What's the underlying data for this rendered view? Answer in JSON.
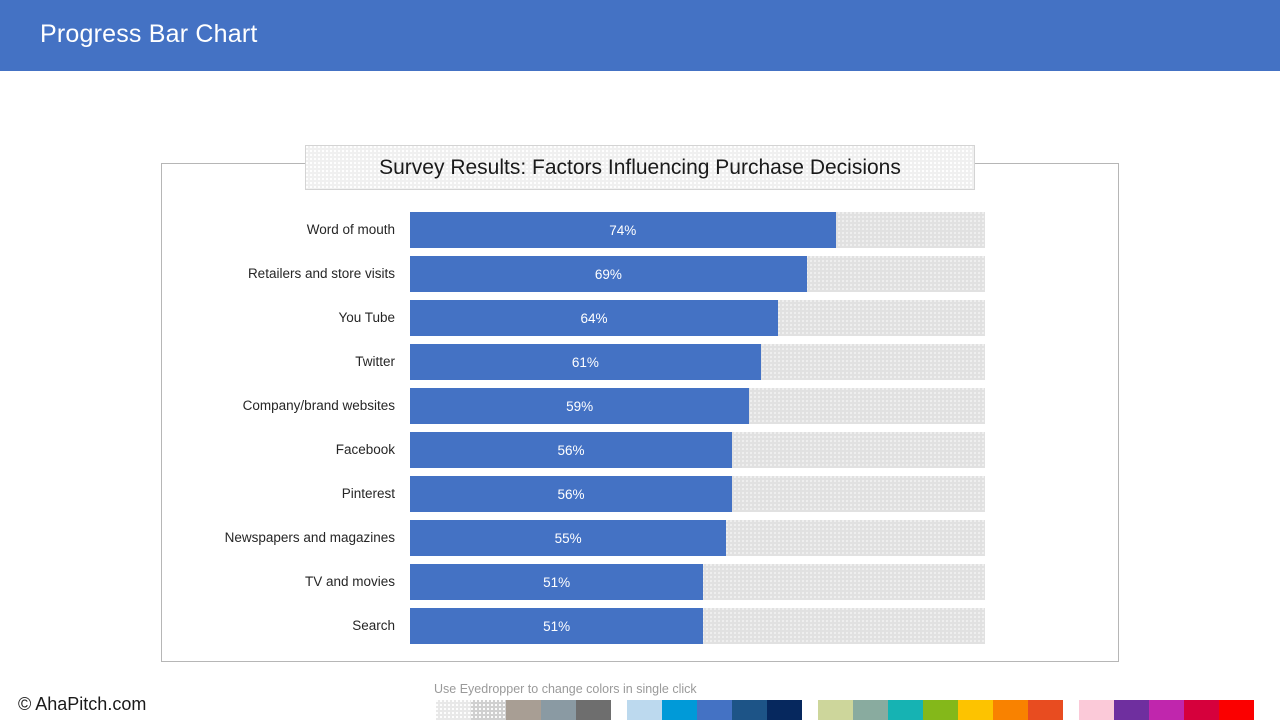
{
  "header": {
    "title": "Progress Bar Chart",
    "background_color": "#4472C4"
  },
  "chart_title": "Survey Results: Factors Influencing Purchase Decisions",
  "footer": {
    "credit": "© AhaPitch.com",
    "eyedropper_hint": "Use Eyedropper to change colors in single click"
  },
  "colors": {
    "bar_fill": "#4472C4",
    "bar_track": "#e1e1e1",
    "frame_border": "#b6b6b6",
    "title_box_fill": "#f0f0f0"
  },
  "palette": [
    {
      "name": "neutrals",
      "swatches": [
        {
          "hex": "#e8e8e8",
          "textured": true
        },
        {
          "hex": "#d0d0d0",
          "textured": true
        },
        {
          "hex": "#a89e94",
          "textured": false
        },
        {
          "hex": "#8a9aa3",
          "textured": false
        },
        {
          "hex": "#6e6e6e",
          "textured": false
        }
      ]
    },
    {
      "name": "blues",
      "swatches": [
        {
          "hex": "#bcd9ee",
          "textured": false
        },
        {
          "hex": "#009ad8",
          "textured": false
        },
        {
          "hex": "#4472C4",
          "textured": false
        },
        {
          "hex": "#1d5487",
          "textured": false
        },
        {
          "hex": "#06285e",
          "textured": false
        }
      ]
    },
    {
      "name": "greens-warms",
      "swatches": [
        {
          "hex": "#cdd69b",
          "textured": false
        },
        {
          "hex": "#89ab9f",
          "textured": false
        },
        {
          "hex": "#16b3b3",
          "textured": false
        },
        {
          "hex": "#84b81a",
          "textured": false
        },
        {
          "hex": "#fdc300",
          "textured": false
        },
        {
          "hex": "#f98200",
          "textured": false
        },
        {
          "hex": "#e84c20",
          "textured": false
        }
      ]
    },
    {
      "name": "pinks-reds",
      "swatches": [
        {
          "hex": "#fbc9d8",
          "textured": false
        },
        {
          "hex": "#6f2f9f",
          "textured": false
        },
        {
          "hex": "#c026ad",
          "textured": false
        },
        {
          "hex": "#d6003c",
          "textured": false
        },
        {
          "hex": "#fb0000",
          "textured": false
        }
      ]
    }
  ],
  "chart_data": {
    "type": "bar",
    "title": "Survey Results: Factors Influencing Purchase Decisions",
    "xlabel": "",
    "ylabel": "",
    "xlim": [
      0,
      100
    ],
    "grid": false,
    "legend": false,
    "orientation": "horizontal",
    "value_suffix": "%",
    "categories": [
      "Word of mouth",
      "Retailers and store visits",
      "You Tube",
      "Twitter",
      "Company/brand websites",
      "Facebook",
      "Pinterest",
      "Newspapers and magazines",
      "TV and movies",
      "Search"
    ],
    "values": [
      74,
      69,
      64,
      61,
      59,
      56,
      56,
      55,
      51,
      51
    ],
    "labels": [
      "74%",
      "69%",
      "64%",
      "61%",
      "59%",
      "56%",
      "56%",
      "55%",
      "51%",
      "51%"
    ]
  }
}
